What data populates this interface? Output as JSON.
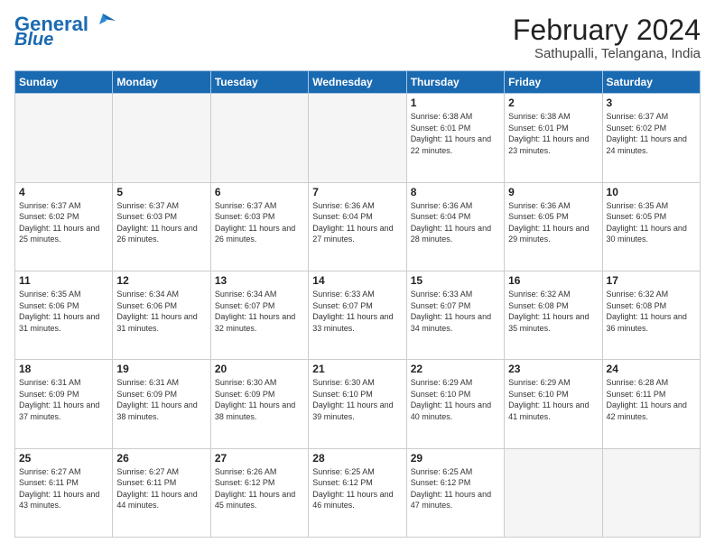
{
  "logo": {
    "line1": "General",
    "line2": "Blue"
  },
  "title": "February 2024",
  "subtitle": "Sathupalli, Telangana, India",
  "weekdays": [
    "Sunday",
    "Monday",
    "Tuesday",
    "Wednesday",
    "Thursday",
    "Friday",
    "Saturday"
  ],
  "weeks": [
    [
      {
        "num": "",
        "info": ""
      },
      {
        "num": "",
        "info": ""
      },
      {
        "num": "",
        "info": ""
      },
      {
        "num": "",
        "info": ""
      },
      {
        "num": "1",
        "info": "Sunrise: 6:38 AM\nSunset: 6:01 PM\nDaylight: 11 hours and 22 minutes."
      },
      {
        "num": "2",
        "info": "Sunrise: 6:38 AM\nSunset: 6:01 PM\nDaylight: 11 hours and 23 minutes."
      },
      {
        "num": "3",
        "info": "Sunrise: 6:37 AM\nSunset: 6:02 PM\nDaylight: 11 hours and 24 minutes."
      }
    ],
    [
      {
        "num": "4",
        "info": "Sunrise: 6:37 AM\nSunset: 6:02 PM\nDaylight: 11 hours and 25 minutes."
      },
      {
        "num": "5",
        "info": "Sunrise: 6:37 AM\nSunset: 6:03 PM\nDaylight: 11 hours and 26 minutes."
      },
      {
        "num": "6",
        "info": "Sunrise: 6:37 AM\nSunset: 6:03 PM\nDaylight: 11 hours and 26 minutes."
      },
      {
        "num": "7",
        "info": "Sunrise: 6:36 AM\nSunset: 6:04 PM\nDaylight: 11 hours and 27 minutes."
      },
      {
        "num": "8",
        "info": "Sunrise: 6:36 AM\nSunset: 6:04 PM\nDaylight: 11 hours and 28 minutes."
      },
      {
        "num": "9",
        "info": "Sunrise: 6:36 AM\nSunset: 6:05 PM\nDaylight: 11 hours and 29 minutes."
      },
      {
        "num": "10",
        "info": "Sunrise: 6:35 AM\nSunset: 6:05 PM\nDaylight: 11 hours and 30 minutes."
      }
    ],
    [
      {
        "num": "11",
        "info": "Sunrise: 6:35 AM\nSunset: 6:06 PM\nDaylight: 11 hours and 31 minutes."
      },
      {
        "num": "12",
        "info": "Sunrise: 6:34 AM\nSunset: 6:06 PM\nDaylight: 11 hours and 31 minutes."
      },
      {
        "num": "13",
        "info": "Sunrise: 6:34 AM\nSunset: 6:07 PM\nDaylight: 11 hours and 32 minutes."
      },
      {
        "num": "14",
        "info": "Sunrise: 6:33 AM\nSunset: 6:07 PM\nDaylight: 11 hours and 33 minutes."
      },
      {
        "num": "15",
        "info": "Sunrise: 6:33 AM\nSunset: 6:07 PM\nDaylight: 11 hours and 34 minutes."
      },
      {
        "num": "16",
        "info": "Sunrise: 6:32 AM\nSunset: 6:08 PM\nDaylight: 11 hours and 35 minutes."
      },
      {
        "num": "17",
        "info": "Sunrise: 6:32 AM\nSunset: 6:08 PM\nDaylight: 11 hours and 36 minutes."
      }
    ],
    [
      {
        "num": "18",
        "info": "Sunrise: 6:31 AM\nSunset: 6:09 PM\nDaylight: 11 hours and 37 minutes."
      },
      {
        "num": "19",
        "info": "Sunrise: 6:31 AM\nSunset: 6:09 PM\nDaylight: 11 hours and 38 minutes."
      },
      {
        "num": "20",
        "info": "Sunrise: 6:30 AM\nSunset: 6:09 PM\nDaylight: 11 hours and 38 minutes."
      },
      {
        "num": "21",
        "info": "Sunrise: 6:30 AM\nSunset: 6:10 PM\nDaylight: 11 hours and 39 minutes."
      },
      {
        "num": "22",
        "info": "Sunrise: 6:29 AM\nSunset: 6:10 PM\nDaylight: 11 hours and 40 minutes."
      },
      {
        "num": "23",
        "info": "Sunrise: 6:29 AM\nSunset: 6:10 PM\nDaylight: 11 hours and 41 minutes."
      },
      {
        "num": "24",
        "info": "Sunrise: 6:28 AM\nSunset: 6:11 PM\nDaylight: 11 hours and 42 minutes."
      }
    ],
    [
      {
        "num": "25",
        "info": "Sunrise: 6:27 AM\nSunset: 6:11 PM\nDaylight: 11 hours and 43 minutes."
      },
      {
        "num": "26",
        "info": "Sunrise: 6:27 AM\nSunset: 6:11 PM\nDaylight: 11 hours and 44 minutes."
      },
      {
        "num": "27",
        "info": "Sunrise: 6:26 AM\nSunset: 6:12 PM\nDaylight: 11 hours and 45 minutes."
      },
      {
        "num": "28",
        "info": "Sunrise: 6:25 AM\nSunset: 6:12 PM\nDaylight: 11 hours and 46 minutes."
      },
      {
        "num": "29",
        "info": "Sunrise: 6:25 AM\nSunset: 6:12 PM\nDaylight: 11 hours and 47 minutes."
      },
      {
        "num": "",
        "info": ""
      },
      {
        "num": "",
        "info": ""
      }
    ]
  ]
}
